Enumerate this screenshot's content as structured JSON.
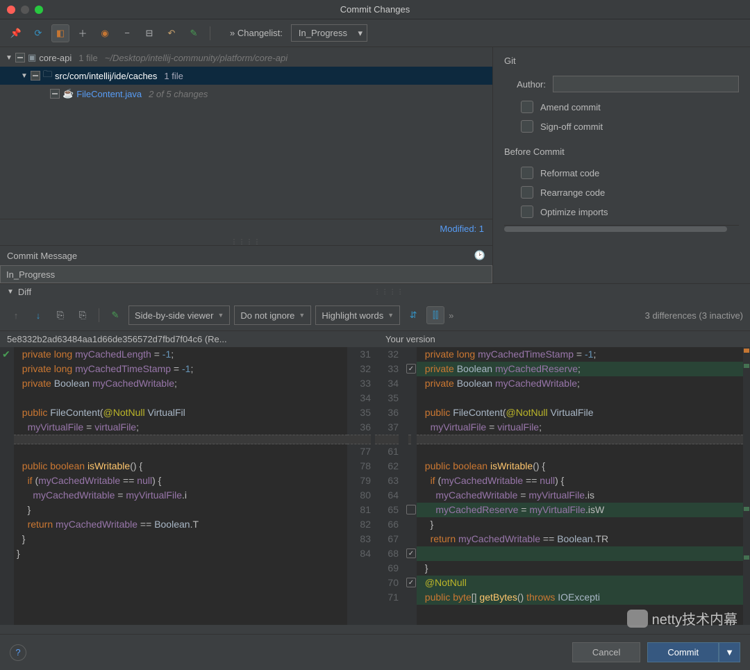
{
  "window": {
    "title": "Commit Changes"
  },
  "changelist": {
    "label": "»  Changelist:",
    "value": "In_Progress"
  },
  "tree": {
    "root": {
      "name": "core-api",
      "count": "1 file",
      "path": "~/Desktop/intellij-community/platform/core-api"
    },
    "dir": {
      "name": "src/com/intellij/ide/caches",
      "count": "1 file"
    },
    "file": {
      "name": "FileContent.java",
      "changes": "2 of 5 changes"
    },
    "modified": "Modified: 1"
  },
  "git": {
    "title": "Git",
    "author_label": "Author:",
    "amend": "Amend commit",
    "signoff": "Sign-off commit",
    "before_title": "Before Commit",
    "reformat": "Reformat code",
    "rearrange": "Rearrange code",
    "optimize": "Optimize imports"
  },
  "commit_msg": {
    "label": "Commit Message",
    "value": "In_Progress"
  },
  "diff": {
    "label": "Diff",
    "viewer": "Side-by-side viewer",
    "ignore": "Do not ignore",
    "highlight": "Highlight words",
    "summary": "3 differences (3 inactive)",
    "left_title": "5e8332b2ad63484aa1d66de356572d7fbd7f04c6 (Re...",
    "right_title": "Your version"
  },
  "code": {
    "left": [
      {
        "n": 31,
        "t": "  private long myCachedLength = -1;"
      },
      {
        "n": 32,
        "t": "  private long myCachedTimeStamp = -1;"
      },
      {
        "n": 33,
        "t": "  private Boolean myCachedWritable;"
      },
      {
        "n": 34,
        "t": ""
      },
      {
        "n": 35,
        "t": "  public FileContent(@NotNull VirtualFil"
      },
      {
        "n": 36,
        "t": "    myVirtualFile = virtualFile;"
      },
      {
        "n": 0,
        "fold": true
      },
      {
        "n": 77,
        "t": ""
      },
      {
        "n": 78,
        "t": "  public boolean isWritable() {"
      },
      {
        "n": 79,
        "t": "    if (myCachedWritable == null) {"
      },
      {
        "n": 80,
        "t": "      myCachedWritable = myVirtualFile.i"
      },
      {
        "n": 81,
        "t": "    }"
      },
      {
        "n": 82,
        "t": "    return myCachedWritable == Boolean.T"
      },
      {
        "n": 83,
        "t": "  }"
      },
      {
        "n": 84,
        "t": "}"
      }
    ],
    "right": [
      {
        "n": 32,
        "t": "  private long myCachedTimeStamp = -1;"
      },
      {
        "n": 33,
        "t": "  private Boolean myCachedReserve;",
        "g": true,
        "chk": true
      },
      {
        "n": 34,
        "t": "  private Boolean myCachedWritable;"
      },
      {
        "n": 35,
        "t": ""
      },
      {
        "n": 36,
        "t": "  public FileContent(@NotNull VirtualFile "
      },
      {
        "n": 37,
        "t": "    myVirtualFile = virtualFile;"
      },
      {
        "n": 0,
        "fold": true
      },
      {
        "n": 61,
        "t": ""
      },
      {
        "n": 62,
        "t": "  public boolean isWritable() {"
      },
      {
        "n": 63,
        "t": "    if (myCachedWritable == null) {"
      },
      {
        "n": 64,
        "t": "      myCachedWritable = myVirtualFile.is"
      },
      {
        "n": 65,
        "t": "      myCachedReserve = myVirtualFile.isW",
        "g": true,
        "chk": false
      },
      {
        "n": 66,
        "t": "    }"
      },
      {
        "n": 67,
        "t": "    return myCachedWritable == Boolean.TR"
      },
      {
        "n": 68,
        "t": "",
        "g": true,
        "chk": true
      },
      {
        "n": 69,
        "t": "  }"
      },
      {
        "n": 70,
        "t": "  @NotNull",
        "g": true,
        "chk": true
      },
      {
        "n": 71,
        "t": "  public byte[] getBytes() throws IOExcepti",
        "g": true
      }
    ]
  },
  "footer": {
    "cancel": "Cancel",
    "commit": "Commit"
  },
  "watermark": "netty技术内幕"
}
